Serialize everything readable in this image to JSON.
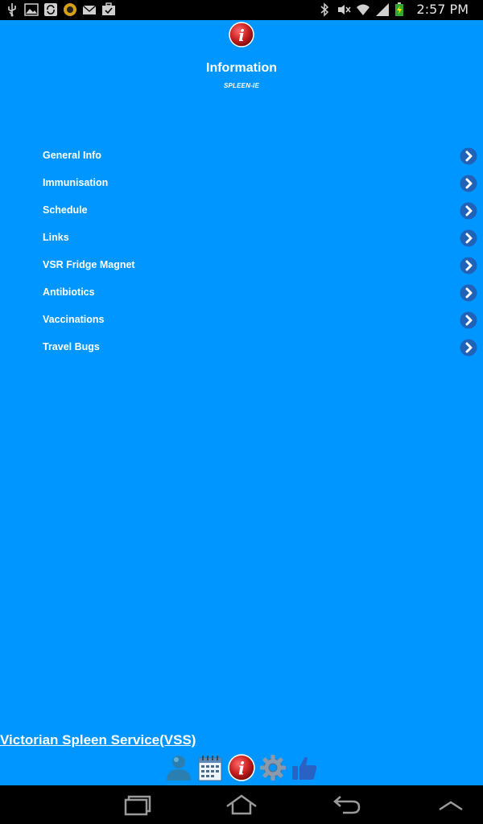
{
  "status_bar": {
    "time": "2:57 PM",
    "left_icons": [
      "usb-icon",
      "image-icon",
      "sync-icon",
      "app-icon",
      "mail-icon",
      "briefcase-check-icon"
    ],
    "right_icons": [
      "bluetooth-icon",
      "mute-icon",
      "wifi-icon",
      "signal-icon",
      "battery-charging-icon"
    ]
  },
  "header": {
    "title": "Information",
    "subtitle": "SPLEEN-IE",
    "icon": "info-icon"
  },
  "menu": {
    "items": [
      {
        "label": "General Info"
      },
      {
        "label": "Immunisation"
      },
      {
        "label": "Schedule"
      },
      {
        "label": "Links"
      },
      {
        "label": "VSR Fridge Magnet"
      },
      {
        "label": "Antibiotics"
      },
      {
        "label": "Vaccinations"
      },
      {
        "label": "Travel Bugs"
      }
    ]
  },
  "footer": {
    "link_text": "Victorian Spleen Service(VSS)",
    "tabs": [
      "person-icon",
      "calendar-icon",
      "info-icon",
      "settings-icon",
      "thumbs-up-icon"
    ]
  },
  "nav_bar": {
    "buttons": [
      "recent-apps-icon",
      "home-icon",
      "back-icon",
      "up-icon"
    ]
  },
  "colors": {
    "background": "#0096ff",
    "chevron": "#1f62b8",
    "info_red": "#c81f1f"
  }
}
